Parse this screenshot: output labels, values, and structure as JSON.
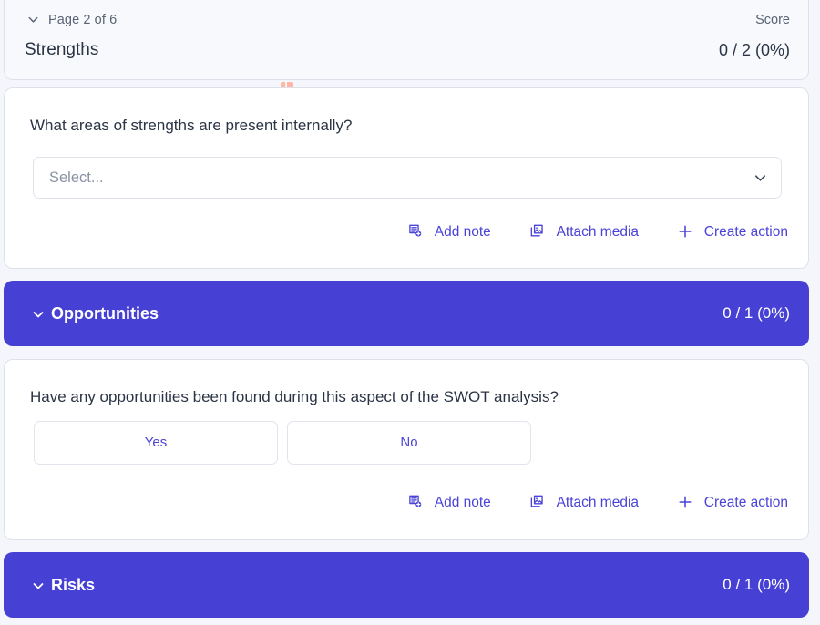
{
  "page_header": {
    "chevron_icon": "chevron-down-icon",
    "page_label": "Page 2 of 6",
    "score_label": "Score",
    "title": "Strengths",
    "score_value": "0 / 2 (0%)"
  },
  "action_links": {
    "add_note": {
      "icon": "note-add-icon",
      "label": "Add note"
    },
    "attach_media": {
      "icon": "image-stack-icon",
      "label": "Attach media"
    },
    "create_action": {
      "icon": "plus-icon",
      "label": "Create action"
    }
  },
  "questions": [
    {
      "text": "What areas of strengths are present internally?",
      "input_type": "select",
      "select_placeholder": "Select...",
      "chevron_icon": "chevron-down-icon"
    },
    {
      "text": "Have any opportunities been found during this aspect of the SWOT analysis?",
      "input_type": "choice",
      "choices": [
        "Yes",
        "No"
      ]
    }
  ],
  "sections": [
    {
      "title": "Opportunities",
      "score_value": "0 / 1 (0%)",
      "chevron_icon": "chevron-down-icon",
      "color": "#4740d4"
    },
    {
      "title": "Risks",
      "score_value": "0 / 1 (0%)",
      "chevron_icon": "chevron-down-icon",
      "color": "#4740d4"
    }
  ],
  "colors": {
    "accent": "#4740d4",
    "link": "#4a43d8",
    "page_background": "#f4f6fb",
    "header_background": "#f7f9fc",
    "text_primary": "#2b3445",
    "text_muted": "#5b6375",
    "marker": "#ffb4a2"
  }
}
